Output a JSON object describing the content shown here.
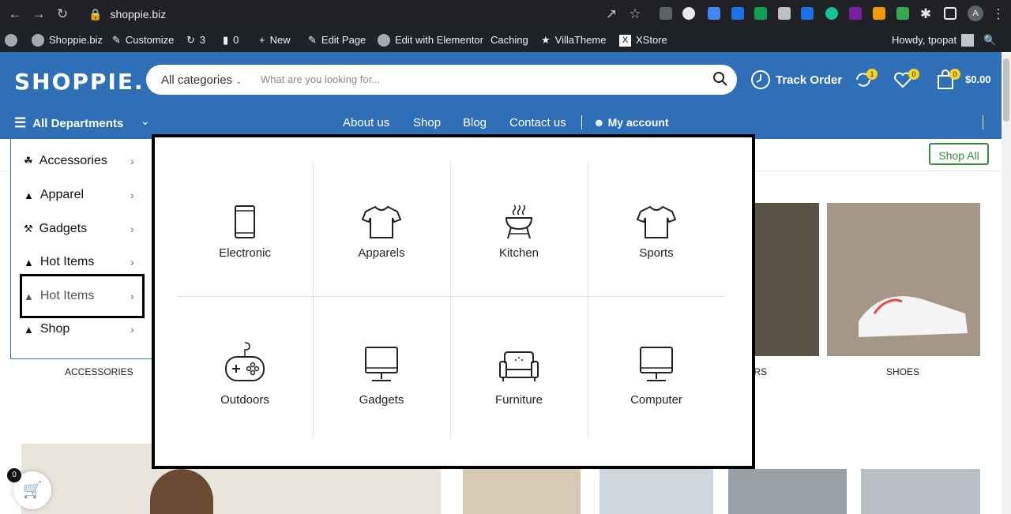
{
  "browser": {
    "url": "shoppie.biz"
  },
  "wp_admin_bar": {
    "site_name": "Shoppie.biz",
    "customize": "Customize",
    "updates": "3",
    "comments": "0",
    "new": "New",
    "edit_page": "Edit Page",
    "elementor": "Edit with Elementor",
    "caching": "Caching",
    "villatheme": "VillaTheme",
    "xstore": "XStore",
    "howdy": "Howdy, tpopat"
  },
  "header": {
    "logo": "SHOPPIE.",
    "search": {
      "category": "All categories",
      "placeholder": "What are you looking for..."
    },
    "track_order": "Track Order",
    "compare_count": "1",
    "wishlist_count": "0",
    "cart_count": "0",
    "cart_total": "$0.00",
    "all_departments": "All Departments",
    "nav": [
      "About us",
      "Shop",
      "Blog",
      "Contact us"
    ],
    "my_account": "My account"
  },
  "shop_all": "Shop All",
  "departments": [
    {
      "label": "Accessories",
      "icon": "accessories-icon"
    },
    {
      "label": "Apparel",
      "icon": "shirt-icon"
    },
    {
      "label": "Gadgets",
      "icon": "gadgets-icon"
    },
    {
      "label": "Hot Items",
      "icon": "shirt-icon"
    },
    {
      "label": "Hot Items",
      "icon": "shirt-icon"
    },
    {
      "label": "Shop",
      "icon": "shirt-icon"
    }
  ],
  "mega_menu": [
    {
      "label": "Electronic",
      "icon": "phone-icon"
    },
    {
      "label": "Apparels",
      "icon": "tshirt-icon"
    },
    {
      "label": "Kitchen",
      "icon": "grill-icon"
    },
    {
      "label": "Sports",
      "icon": "tshirt-icon"
    },
    {
      "label": "Outdoors",
      "icon": "gamepad-icon"
    },
    {
      "label": "Gadgets",
      "icon": "monitor-icon"
    },
    {
      "label": "Furniture",
      "icon": "sofa-icon"
    },
    {
      "label": "Computer",
      "icon": "monitor-icon"
    }
  ],
  "category_labels": {
    "accessories": "ACCESSORIES",
    "partial": "ORS",
    "shoes": "SHOES"
  },
  "floating_cart_count": "0",
  "colors": {
    "brand_blue": "#2f6fb8",
    "badge_yellow": "#f7d51d",
    "shop_all_green": "#3a8a3a"
  }
}
